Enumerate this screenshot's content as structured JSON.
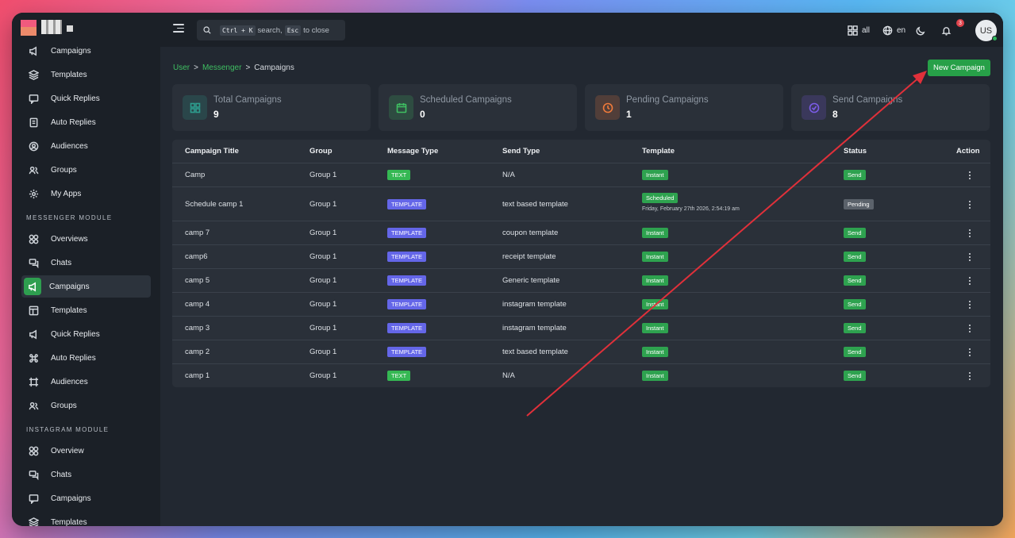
{
  "topbar": {
    "search_kbd1": "Ctrl + K",
    "search_text1": "search,",
    "search_kbd2": "Esc",
    "search_text2": "to close",
    "apps_label": "all",
    "lang_label": "en",
    "notification_count": "3",
    "avatar_initials": "US"
  },
  "sidebar": {
    "top_items": [
      {
        "label": "Campaigns",
        "icon": "megaphone-icon"
      },
      {
        "label": "Templates",
        "icon": "layers-icon"
      },
      {
        "label": "Quick Replies",
        "icon": "chat-square-icon"
      },
      {
        "label": "Auto Replies",
        "icon": "file-icon"
      },
      {
        "label": "Audiences",
        "icon": "user-circle-icon"
      },
      {
        "label": "Groups",
        "icon": "users-icon"
      },
      {
        "label": "My Apps",
        "icon": "gear-icon"
      }
    ],
    "messenger_section": "MESSENGER MODULE",
    "messenger_items": [
      {
        "label": "Overviews",
        "icon": "grid-icon"
      },
      {
        "label": "Chats",
        "icon": "chat-icon"
      },
      {
        "label": "Campaigns",
        "icon": "megaphone-icon"
      },
      {
        "label": "Templates",
        "icon": "layout-icon"
      },
      {
        "label": "Quick Replies",
        "icon": "megaphone-icon"
      },
      {
        "label": "Auto Replies",
        "icon": "command-icon"
      },
      {
        "label": "Audiences",
        "icon": "frame-icon"
      },
      {
        "label": "Groups",
        "icon": "users-icon"
      }
    ],
    "instagram_section": "INSTAGRAM MODULE",
    "instagram_items": [
      {
        "label": "Overview",
        "icon": "grid-icon"
      },
      {
        "label": "Chats",
        "icon": "chat-icon"
      },
      {
        "label": "Campaigns",
        "icon": "chat-square-icon"
      },
      {
        "label": "Templates",
        "icon": "layers-icon"
      }
    ]
  },
  "breadcrumb": {
    "user": "User",
    "sep": ">",
    "messenger": "Messenger",
    "current": "Campaigns"
  },
  "new_campaign_label": "New Campaign",
  "stats": [
    {
      "label": "Total Campaigns",
      "value": "9",
      "color": "#2e9e8f"
    },
    {
      "label": "Scheduled Campaigns",
      "value": "0",
      "color": "#3fbf62"
    },
    {
      "label": "Pending Campaigns",
      "value": "1",
      "color": "#f07a3a"
    },
    {
      "label": "Send Campaigns",
      "value": "8",
      "color": "#7b5ce8"
    }
  ],
  "table": {
    "headers": [
      "Campaign Title",
      "Group",
      "Message Type",
      "Send Type",
      "Template",
      "Status",
      "Action"
    ],
    "rows": [
      {
        "title": "Camp",
        "group": "Group 1",
        "msg_type": "TEXT",
        "send_type": "N/A",
        "template": "Instant",
        "template_date": "",
        "status": "Send"
      },
      {
        "title": "Schedule camp 1",
        "group": "Group 1",
        "msg_type": "TEMPLATE",
        "send_type": "text based template",
        "template": "Scheduled",
        "template_date": "Friday, February 27th 2026, 2:54:19 am",
        "status": "Pending"
      },
      {
        "title": "camp 7",
        "group": "Group 1",
        "msg_type": "TEMPLATE",
        "send_type": "coupon template",
        "template": "Instant",
        "template_date": "",
        "status": "Send"
      },
      {
        "title": "camp6",
        "group": "Group 1",
        "msg_type": "TEMPLATE",
        "send_type": "receipt template",
        "template": "Instant",
        "template_date": "",
        "status": "Send"
      },
      {
        "title": "camp 5",
        "group": "Group 1",
        "msg_type": "TEMPLATE",
        "send_type": "Generic template",
        "template": "Instant",
        "template_date": "",
        "status": "Send"
      },
      {
        "title": "camp 4",
        "group": "Group 1",
        "msg_type": "TEMPLATE",
        "send_type": "instagram template",
        "template": "Instant",
        "template_date": "",
        "status": "Send"
      },
      {
        "title": "camp 3",
        "group": "Group 1",
        "msg_type": "TEMPLATE",
        "send_type": "instagram template",
        "template": "Instant",
        "template_date": "",
        "status": "Send"
      },
      {
        "title": "camp 2",
        "group": "Group 1",
        "msg_type": "TEMPLATE",
        "send_type": "text based template",
        "template": "Instant",
        "template_date": "",
        "status": "Send"
      },
      {
        "title": "camp 1",
        "group": "Group 1",
        "msg_type": "TEXT",
        "send_type": "N/A",
        "template": "Instant",
        "template_date": "",
        "status": "Send"
      }
    ]
  },
  "annotation_arrow_color": "#e0303a"
}
